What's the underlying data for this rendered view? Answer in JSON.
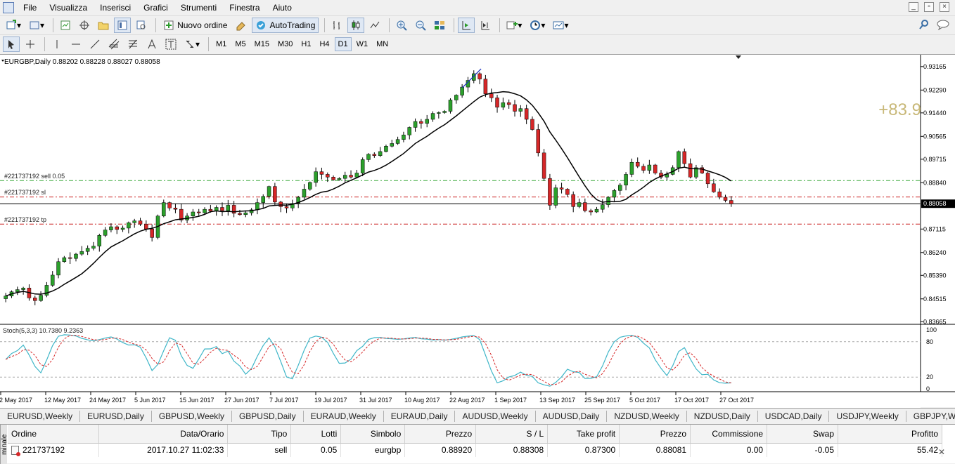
{
  "menu": [
    "File",
    "Visualizza",
    "Inserisci",
    "Grafici",
    "Strumenti",
    "Finestra",
    "Aiuto"
  ],
  "toolbar": {
    "new_order": "Nuovo ordine",
    "autotrading": "AutoTrading",
    "timeframes": [
      "M1",
      "M5",
      "M15",
      "M30",
      "H1",
      "H4",
      "D1",
      "W1",
      "MN"
    ],
    "active_timeframe": "D1"
  },
  "chart": {
    "header": "EURGBP,Daily  0.88202 0.88228 0.88027 0.88058",
    "profit_overlay": "+83.9",
    "order_lines": {
      "sell": "#221737192 sell 0.05",
      "sl": "#221737192 sl",
      "tp": "#221737192 tp"
    },
    "current_price_label": "0.88058",
    "price_ticks": [
      "0.93165",
      "0.92290",
      "0.91440",
      "0.90565",
      "0.89715",
      "0.88840",
      "0.87115",
      "0.86240",
      "0.85390",
      "0.84515",
      "0.83665"
    ],
    "stoch_header": "Stoch(5,3,3) 10.7380 9.2363",
    "stoch_ticks": [
      "100",
      "80",
      "20",
      "0"
    ],
    "date_ticks": [
      "2 May 2017",
      "12 May 2017",
      "24 May 2017",
      "5 Jun 2017",
      "15 Jun 2017",
      "27 Jun 2017",
      "7 Jul 2017",
      "19 Jul 2017",
      "31 Jul 2017",
      "10 Aug 2017",
      "22 Aug 2017",
      "1 Sep 2017",
      "13 Sep 2017",
      "25 Sep 2017",
      "5 Oct 2017",
      "17 Oct 2017",
      "27 Oct 2017"
    ],
    "colors": {
      "bull": "#2ca02c",
      "bear": "#d62728",
      "ma": "#000000",
      "sell_line": "#3aa83a",
      "sl_tp_line": "#cc2222",
      "stoch_main": "#3fb6c8",
      "stoch_signal": "#d62728",
      "profit": "#c8b878"
    }
  },
  "chart_data": {
    "type": "candlestick",
    "symbol": "EURGBP",
    "timeframe": "Daily",
    "ylim": [
      0.8362,
      0.935
    ],
    "closes": [
      0.8462,
      0.8478,
      0.8486,
      0.8492,
      0.8455,
      0.8445,
      0.8465,
      0.8502,
      0.854,
      0.859,
      0.8605,
      0.8602,
      0.8618,
      0.8628,
      0.864,
      0.8648,
      0.8688,
      0.8708,
      0.872,
      0.871,
      0.8715,
      0.8735,
      0.8742,
      0.873,
      0.8712,
      0.868,
      0.876,
      0.881,
      0.879,
      0.8785,
      0.8745,
      0.876,
      0.8775,
      0.8772,
      0.8785,
      0.8778,
      0.8792,
      0.878,
      0.88,
      0.877,
      0.8765,
      0.8772,
      0.8783,
      0.881,
      0.8833,
      0.887,
      0.8812,
      0.8795,
      0.879,
      0.8807,
      0.883,
      0.886,
      0.8885,
      0.8925,
      0.8915,
      0.8905,
      0.8895,
      0.89,
      0.8912,
      0.8905,
      0.892,
      0.897,
      0.899,
      0.8985,
      0.9,
      0.902,
      0.903,
      0.9045,
      0.9062,
      0.909,
      0.9112,
      0.9105,
      0.912,
      0.9142,
      0.9145,
      0.915,
      0.9192,
      0.921,
      0.924,
      0.9265,
      0.929,
      0.927,
      0.9215,
      0.92,
      0.9165,
      0.9182,
      0.9175,
      0.915,
      0.916,
      0.912,
      0.9082,
      0.8995,
      0.89,
      0.88,
      0.8865,
      0.886,
      0.884,
      0.8795,
      0.881,
      0.878,
      0.8775,
      0.8785,
      0.8802,
      0.883,
      0.8855,
      0.8875,
      0.8915,
      0.896,
      0.8945,
      0.893,
      0.895,
      0.892,
      0.8905,
      0.8915,
      0.894,
      0.9,
      0.8955,
      0.8905,
      0.894,
      0.892,
      0.888,
      0.885,
      0.883,
      0.8818,
      0.88058
    ],
    "moving_average": "dark line, ~10-period",
    "stochastic": {
      "k": 5,
      "d": 3,
      "slowing": 3,
      "main": 10.738,
      "signal": 9.2363,
      "levels": [
        80,
        20
      ]
    },
    "horizontal_lines": [
      {
        "label": "#221737192 sell 0.05",
        "price": 0.8892
      },
      {
        "label": "#221737192 sl",
        "price": 0.88308
      },
      {
        "label": "#221737192 tp",
        "price": 0.873
      },
      {
        "label": "current",
        "price": 0.88058
      }
    ]
  },
  "symbol_tabs": [
    "EURUSD,Weekly",
    "EURUSD,Daily",
    "GBPUSD,Weekly",
    "GBPUSD,Daily",
    "EURAUD,Weekly",
    "EURAUD,Daily",
    "AUDUSD,Weekly",
    "AUDUSD,Daily",
    "NZDUSD,Weekly",
    "NZDUSD,Daily",
    "USDCAD,Daily",
    "USDJPY,Weekly",
    "GBPJPY,Weekly"
  ],
  "terminal": {
    "side_label": "minale",
    "columns": [
      "Ordine",
      "Data/Orario",
      "Tipo",
      "Lotti",
      "Simbolo",
      "Prezzo",
      "S / L",
      "Take profit",
      "Prezzo",
      "Commissione",
      "Swap",
      "Profitto"
    ],
    "row": {
      "order": "221737192",
      "datetime": "2017.10.27 11:02:33",
      "type": "sell",
      "lots": "0.05",
      "symbol": "eurgbp",
      "price": "0.88920",
      "sl": "0.88308",
      "tp": "0.87300",
      "current_price": "0.88081",
      "commission": "0.00",
      "swap": "-0.05",
      "profit": "55.42"
    }
  }
}
